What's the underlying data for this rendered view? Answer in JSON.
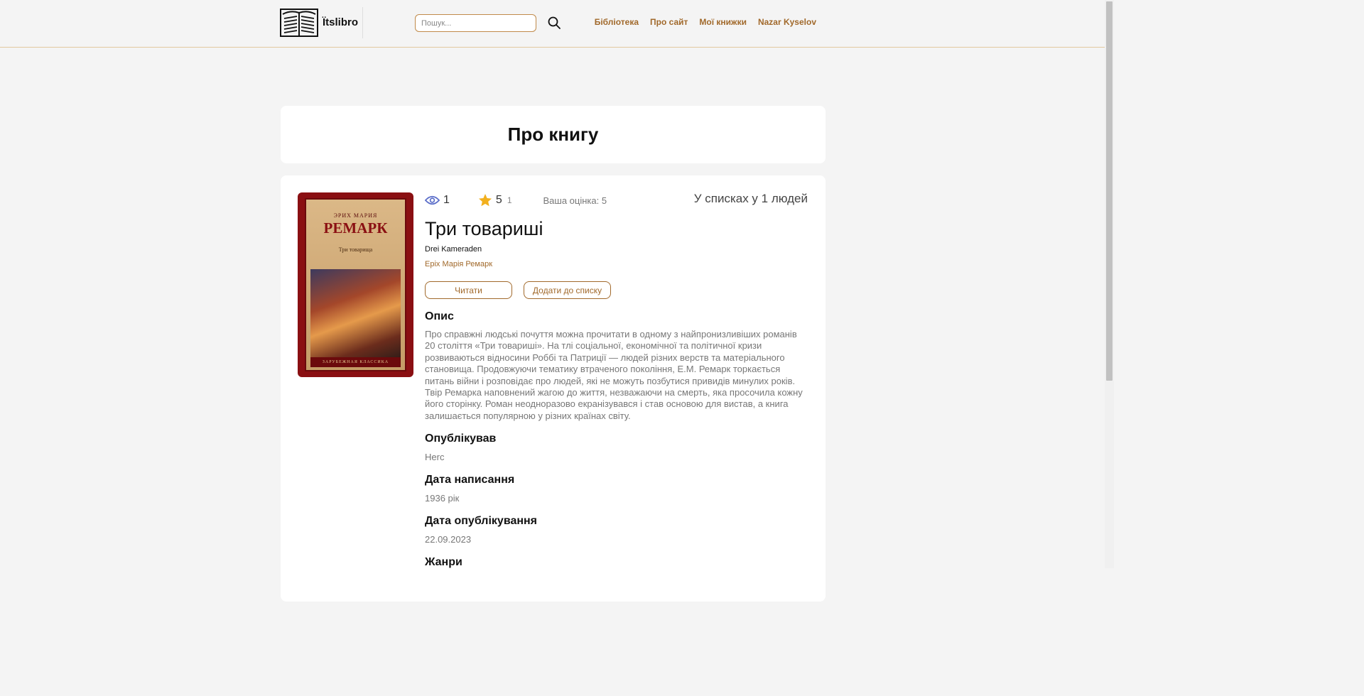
{
  "header": {
    "logo_text": "Ïtslibro",
    "search_placeholder": "Пошук...",
    "nav": [
      "Бібліотека",
      "Про сайт",
      "Мої книжки",
      "Nazar Kyselov"
    ]
  },
  "page_title": "Про книгу",
  "book": {
    "cover": {
      "author_top": "ЭРИХ МАРИЯ",
      "author": "РЕМАРК",
      "subtitle": "Три товарища",
      "series": "ЗАРУБЕЖНАЯ КЛАССИКА"
    },
    "views": "1",
    "rating": "5",
    "rating_count": "1",
    "your_rating": "Ваша оцінка: 5",
    "in_lists": "У списках у 1 людей",
    "title": "Три товариші",
    "original_title": "Drei Kameraden",
    "author": "Еріх Марія Ремарк",
    "read_button": "Читати",
    "add_to_list_button": "Додати до списку",
    "description_heading": "Опис",
    "description": "Про справжні людські почуття можна прочитати в одному з найпронизливіших романів 20 століття «Три товариші». На тлі соціальної, економічної та політичної кризи розвиваються відносини Роббі та Патриції — людей різних верств та матеріального становища. Продовжуючи тематику втраченого покоління, Е.М. Ремарк торкається питань війни і розповідає про людей, які не можуть позбутися привидів минулих років. Твір Ремарка наповнений жагою до життя, незважаючи на смерть, яка просочила кожну його сторінку. Роман неодноразово екранізувався і став основою для вистав, а книга залишається популярною у різних країнах світу.",
    "published_by_heading": "Опублікував",
    "published_by": "Herc",
    "written_date_heading": "Дата написання",
    "written_date": "1936 рік",
    "published_date_heading": "Дата опублікування",
    "published_date": "22.09.2023",
    "genres_heading": "Жанри"
  },
  "colors": {
    "accent": "#a1692b",
    "background": "#f4f4f4",
    "card": "#ffffff",
    "star": "#f2b01e",
    "eye": "#5b6ec9"
  }
}
